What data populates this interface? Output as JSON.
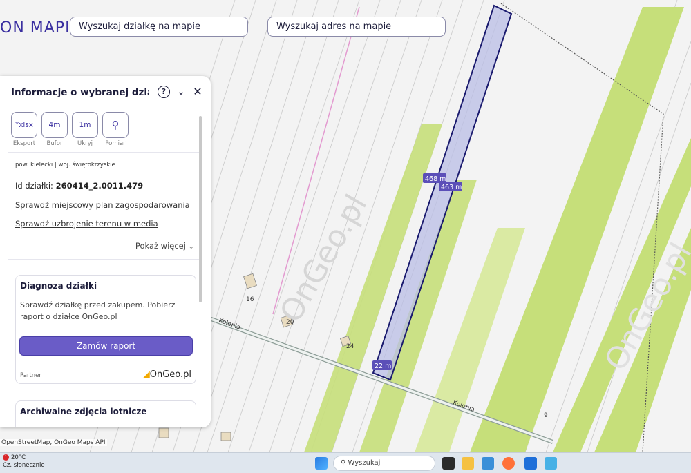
{
  "header": {
    "logo_text": "ON MAPIE",
    "search_parcel_placeholder": "Wyszukaj działkę na mapie",
    "search_address_placeholder": "Wyszukaj adres na mapie"
  },
  "panel": {
    "title": "Informacje o wybranej dział...",
    "help_glyph": "?",
    "collapse_glyph": "⌄",
    "close_glyph": "✕",
    "tools": [
      {
        "glyph": "*xlsx",
        "label": "Eksport"
      },
      {
        "glyph": "4m",
        "label": "Bufor"
      },
      {
        "glyph": "1m",
        "label": "Ukryj"
      },
      {
        "glyph": "⚲",
        "label": "Pomiar"
      }
    ],
    "location": "pow. kielecki | woj. świętokrzyskie",
    "parcel_id_label": "Id działki:",
    "parcel_id_value": "260414_2.0011.479",
    "link_plan": "Sprawdź miejscowy plan zagospodarowania",
    "link_media": "Sprawdź uzbrojenie terenu w media",
    "show_more": "Pokaż więcej",
    "diagnosis": {
      "title": "Diagnoza działki",
      "text": "Sprawdź działkę przed zakupem. Pobierz raport o działce OnGeo.pl",
      "button": "Zamów raport",
      "partner_label": "Partner",
      "partner_brand": "OnGeo.pl"
    },
    "archive_title": "Archiwalne zdjęcia lotnicze"
  },
  "map": {
    "measure_1": "468 m",
    "measure_2": "463 m",
    "measure_3": "22 m",
    "road_label": "Kolonia",
    "house_numbers": [
      "16",
      "20",
      "24",
      "9"
    ],
    "watermark": "OnGeo.pl",
    "attribution": "OpenStreetMap, OnGeo Maps API",
    "colors": {
      "parcel_fill": "#b9bde6",
      "parcel_stroke": "#1a1a6e",
      "field_green": "#c6df7a",
      "field_white": "#f4f4f4"
    }
  },
  "taskbar": {
    "weather_temp": "20°C",
    "weather_desc": "Cz. słonecznie",
    "weather_badge": "1",
    "search_placeholder": "Wyszukaj"
  }
}
